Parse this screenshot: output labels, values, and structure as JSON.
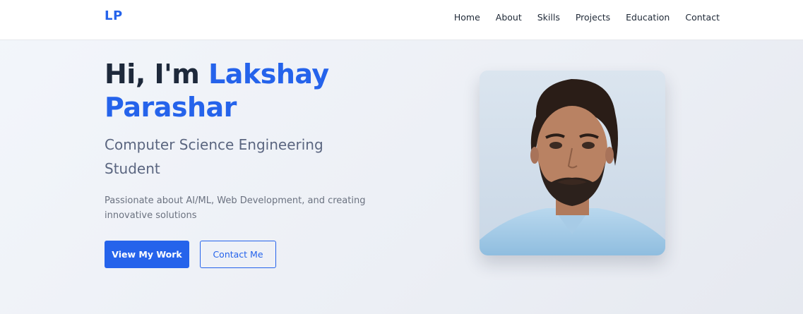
{
  "nav": {
    "logo": "LP",
    "links": [
      "Home",
      "About",
      "Skills",
      "Projects",
      "Education",
      "Contact"
    ]
  },
  "hero": {
    "greeting": "Hi, I'm ",
    "name": "Lakshay Parashar",
    "subtitle": "Computer Science Engineering Student",
    "description": "Passionate about AI/ML, Web Development, and creating innovative solutions",
    "primary_button": "View My Work",
    "secondary_button": "Contact Me"
  },
  "colors": {
    "accent": "#2563eb",
    "heading": "#1e293b",
    "muted": "#5b6680"
  },
  "profile_image": {
    "icon": "profile-photo"
  }
}
